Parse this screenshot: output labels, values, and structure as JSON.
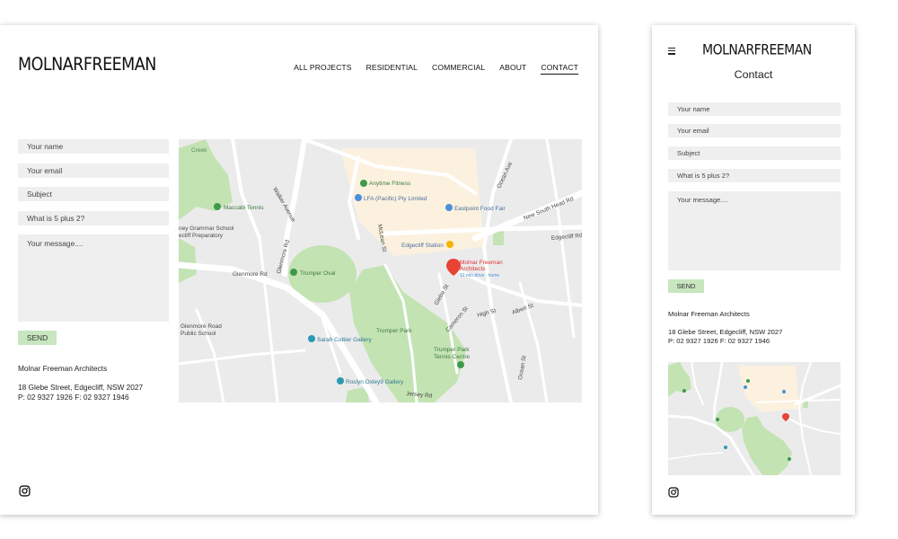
{
  "brand": "MOLNARFREEMAN",
  "nav": [
    "ALL PROJECTS",
    "RESIDENTIAL",
    "COMMERCIAL",
    "ABOUT",
    "CONTACT"
  ],
  "nav_active_index": 4,
  "form": {
    "name_placeholder": "Your name",
    "email_placeholder": "Your email",
    "subject_placeholder": "Subject",
    "captcha_placeholder": "What is 5 plus 2?",
    "message_placeholder": "Your message....",
    "send_label": "SEND"
  },
  "address": {
    "company": "Molnar Freeman Architects",
    "street": "18 Glebe Street, Edgecliff, NSW 2027",
    "phones": "P: 02 9327 1926 F: 02 9327 1946"
  },
  "map": {
    "labels": {
      "creek": "Creek",
      "anytime": "Anytime Fitness",
      "lfa": "LFA (Pacific) Pty Limited",
      "eastpoint": "Eastpoint Food Fair",
      "maccabi": "Maccabi Tennis",
      "grammar": "ney Grammar School",
      "grammar2": "ecliff Preparatory",
      "edgecliff_station": "Edgecliff Station",
      "molnar1": "Molnar Freeman",
      "molnar2": "Architects",
      "drive": "12 min drive · home",
      "trumper_oval": "Trumper Oval",
      "glenmore_rd": "Glenmore Rd",
      "glenmore_school1": "Glenmore Road",
      "glenmore_school2": "Public School",
      "sarah": "Sarah Cottier Gallery",
      "trumper_park": "Trumper Park",
      "trumper_tennis1": "Trumper Park",
      "trumper_tennis2": "Tennis Centre",
      "roslyn": "Roslyn Oxley9 Gallery",
      "ocean_ave": "Ocean Ave",
      "new_south_head": "New South Head Rd",
      "edgecliff_rd": "Edgecliff Rd",
      "glenmore_rd2": "Glenmore Rd",
      "walker_ave": "Walker Avenue",
      "mclean_st": "McLean St",
      "glebe_st": "Glebe St",
      "albert_st": "Albert St",
      "high_st": "High St",
      "cameron_st": "Cameron St",
      "ocean_st": "Ocean St",
      "jersey_rd": "Jersey Rd"
    },
    "colors": {
      "park": "#c3e3b3",
      "road": "#ffffff",
      "base": "#ecebec",
      "commercial": "#fbf1de",
      "pin": "#e84335",
      "poi_blue": "#4a90d9",
      "poi_green": "#3d9a4b"
    }
  },
  "mobile": {
    "title": "Contact"
  },
  "icons": {
    "instagram": "instagram-icon",
    "menu": "hamburger-menu-icon",
    "pin": "map-pin-icon"
  }
}
